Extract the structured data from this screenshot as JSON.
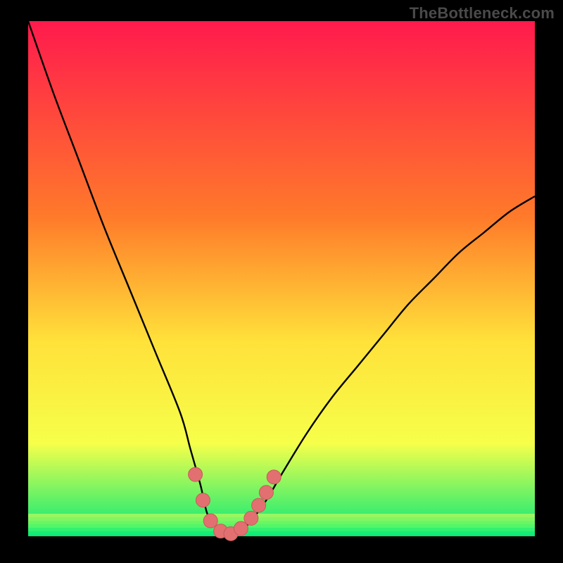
{
  "watermark": "TheBottleneck.com",
  "colors": {
    "background": "#000000",
    "grad_top": "#ff1a4d",
    "grad_mid1": "#ff7a2a",
    "grad_mid2": "#ffe13a",
    "grad_mid3": "#f6ff4a",
    "grad_bottom": "#00e87a",
    "curve": "#000000",
    "marker_fill": "#e27070",
    "marker_stroke": "#c85a5a"
  },
  "chart_data": {
    "type": "line",
    "title": "",
    "xlabel": "",
    "ylabel": "",
    "xlim": [
      0,
      100
    ],
    "ylim": [
      0,
      100
    ],
    "series": [
      {
        "name": "bottleneck-curve",
        "x": [
          0,
          5,
          10,
          15,
          20,
          25,
          30,
          32,
          34,
          35.5,
          38,
          40,
          42,
          44,
          47,
          50,
          55,
          60,
          65,
          70,
          75,
          80,
          85,
          90,
          95,
          100
        ],
        "values": [
          100,
          86,
          73,
          60,
          48,
          36,
          24,
          17,
          10,
          4,
          1,
          0,
          1,
          3,
          7,
          12,
          20,
          27,
          33,
          39,
          45,
          50,
          55,
          59,
          63,
          66
        ]
      }
    ],
    "markers": [
      {
        "x": 33.0,
        "y": 12.0
      },
      {
        "x": 34.5,
        "y": 7.0
      },
      {
        "x": 36.0,
        "y": 3.0
      },
      {
        "x": 38.0,
        "y": 1.0
      },
      {
        "x": 40.0,
        "y": 0.5
      },
      {
        "x": 42.0,
        "y": 1.5
      },
      {
        "x": 44.0,
        "y": 3.5
      },
      {
        "x": 45.5,
        "y": 6.0
      },
      {
        "x": 47.0,
        "y": 8.5
      },
      {
        "x": 48.5,
        "y": 11.5
      }
    ]
  }
}
